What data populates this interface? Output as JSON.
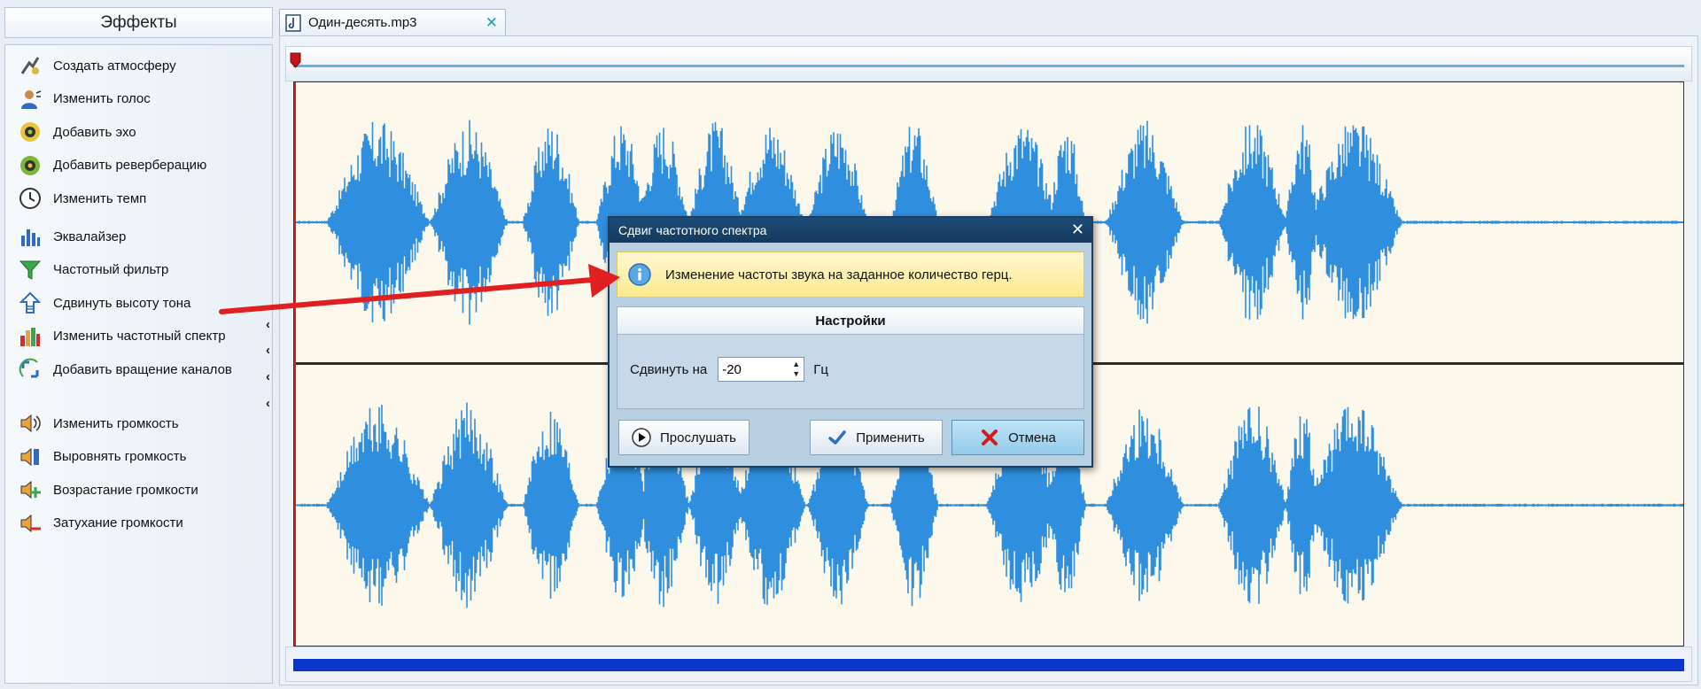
{
  "effects_panel": {
    "title": "Эффекты",
    "groups": [
      [
        {
          "label": "Создать атмосферу",
          "icon": "atmosphere-icon"
        },
        {
          "label": "Изменить голос",
          "icon": "voice-icon"
        },
        {
          "label": "Добавить эхо",
          "icon": "echo-icon"
        },
        {
          "label": "Добавить реверберацию",
          "icon": "reverb-icon"
        },
        {
          "label": "Изменить темп",
          "icon": "tempo-clock-icon"
        }
      ],
      [
        {
          "label": "Эквалайзер",
          "icon": "equalizer-icon"
        },
        {
          "label": "Частотный фильтр",
          "icon": "funnel-filter-icon"
        },
        {
          "label": "Сдвинуть высоту тона",
          "icon": "pitch-arrow-icon"
        },
        {
          "label": "Изменить частотный спектр",
          "icon": "spectrum-bars-icon"
        },
        {
          "label": "Добавить вращение каналов",
          "icon": "channel-rotate-icon"
        }
      ],
      [
        {
          "label": "Изменить громкость",
          "icon": "volume-icon"
        },
        {
          "label": "Выровнять громкость",
          "icon": "normalize-volume-icon"
        },
        {
          "label": "Возрастание громкости",
          "icon": "fade-in-icon"
        },
        {
          "label": "Затухание громкости",
          "icon": "fade-out-icon"
        }
      ]
    ],
    "collapse_glyph": "‹"
  },
  "document_tab": {
    "label": "Один-десять.mp3",
    "close_glyph": "✕"
  },
  "dialog": {
    "title": "Сдвиг частотного спектра",
    "close_glyph": "✕",
    "info_text": "Изменение частоты звука на заданное количество герц.",
    "settings_header": "Настройки",
    "shift_label": "Сдвинуть на",
    "shift_value": "-20",
    "shift_unit": "Гц",
    "preview_label": "Прослушать",
    "apply_label": "Применить",
    "cancel_label": "Отмена"
  },
  "colors": {
    "waveform": "#2f8fde",
    "waveform_bg": "#fdf8ec",
    "playhead": "#d82222",
    "annotation_arrow": "#e02020",
    "dialog_title": "#1a446b"
  }
}
